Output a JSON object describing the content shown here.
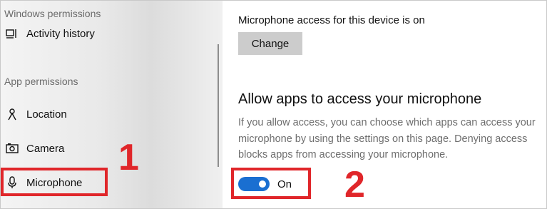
{
  "sidebar": {
    "windows_permissions_header": "Windows permissions",
    "app_permissions_header": "App permissions",
    "items": [
      {
        "label": "Activity history",
        "icon": "activity-history-icon"
      },
      {
        "label": "Location",
        "icon": "location-icon"
      },
      {
        "label": "Camera",
        "icon": "camera-icon"
      },
      {
        "label": "Microphone",
        "icon": "microphone-icon"
      }
    ]
  },
  "main": {
    "device_status": "Microphone access for this device is on",
    "change_button": "Change",
    "section_title": "Allow apps to access your microphone",
    "description": "If you allow access, you can choose which apps can access your microphone by using the settings on this page. Denying access blocks apps from accessing your microphone.",
    "toggle": {
      "state": "On",
      "on": true
    }
  },
  "annotations": {
    "marker_1": "1",
    "marker_2": "2"
  },
  "colors": {
    "accent": "#1a6fd1",
    "annotation": "#e0262a"
  }
}
